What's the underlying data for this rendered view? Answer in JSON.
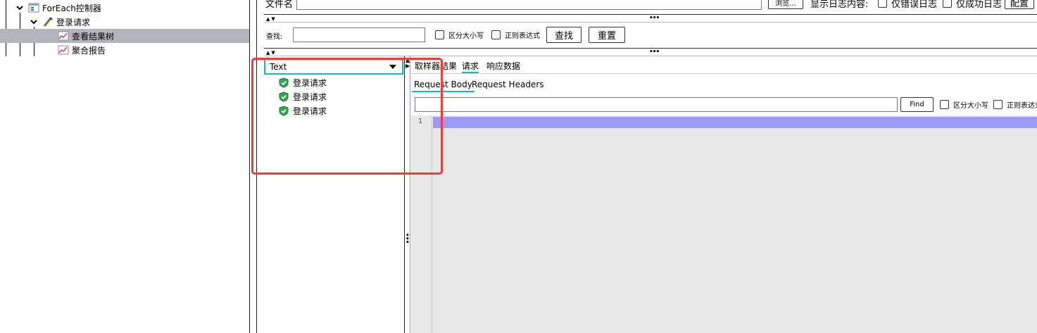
{
  "tree": {
    "items": [
      {
        "label": "ForEach控制器",
        "icon": "controller-icon"
      },
      {
        "label": "登录请求",
        "icon": "sampler-icon"
      },
      {
        "label": "查看结果树",
        "icon": "listener-icon"
      },
      {
        "label": "聚合报告",
        "icon": "listener-icon"
      }
    ]
  },
  "top": {
    "filename_label": "文件名",
    "browse_label": "浏览...",
    "log_label": "显示日志内容:",
    "errors_only_label": "仅错误日志",
    "success_only_label": "仅成功日志",
    "config_label": "配置"
  },
  "search": {
    "label": "查找:",
    "case_label": "区分大小写",
    "regex_label": "正则表达式",
    "find_label": "查找",
    "reset_label": "重置"
  },
  "results": {
    "renderer": "Text",
    "items": [
      "登录请求",
      "登录请求",
      "登录请求"
    ]
  },
  "detail": {
    "tabs": [
      "取样器结果",
      "请求",
      "响应数据"
    ],
    "subtabs": [
      "Request Body",
      "Request Headers"
    ],
    "find_label": "Find",
    "case_label": "区分大小写",
    "regex_label": "正则表达式",
    "line_number": "1"
  },
  "colors": {
    "selection": "#b4b4bd",
    "accent": "#16b8c9",
    "highlight_line": "#9a9afb",
    "annotation": "#ee3b3b"
  }
}
